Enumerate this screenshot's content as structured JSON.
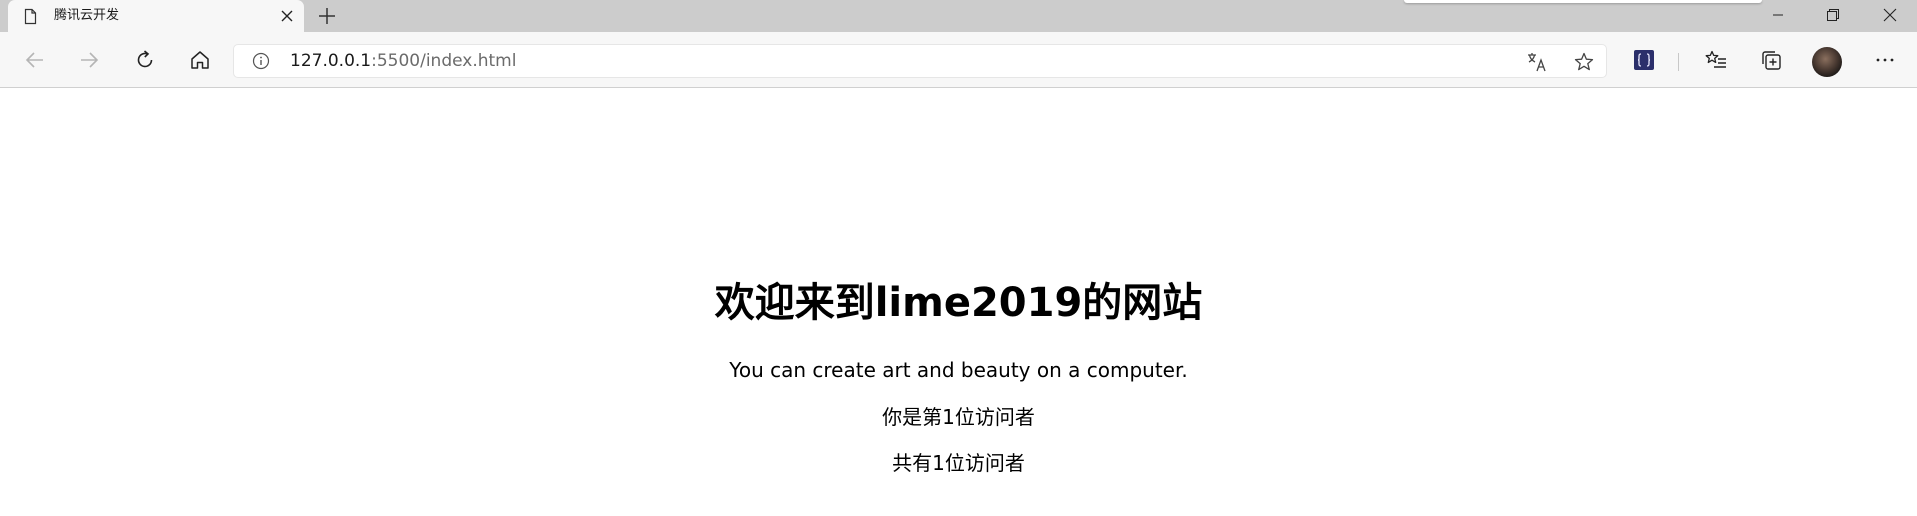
{
  "browser": {
    "tab": {
      "title": "腾讯云开发",
      "page_icon": "document-icon",
      "close_icon": "close-icon"
    },
    "new_tab_icon": "plus-icon",
    "window_controls": [
      "minimize-icon",
      "restore-icon",
      "close-icon"
    ],
    "nav": {
      "back_icon": "arrow-left-icon",
      "forward_icon": "arrow-right-icon",
      "refresh_icon": "refresh-icon",
      "home_icon": "home-icon"
    },
    "address": {
      "host": "127.0.0.1",
      "rest": ":5500/index.html",
      "info_icon": "info-icon"
    },
    "toolbar_icons": [
      "translate-icon",
      "star-icon",
      "extension-icon",
      "favorites-icon",
      "collections-icon",
      "avatar",
      "more-icon"
    ]
  },
  "page": {
    "heading": "欢迎来到lime2019的网站",
    "tagline": "You can create art and beauty on a computer.",
    "visitor_rank": "你是第1位访问者",
    "visitor_total": "共有1位访问者"
  },
  "colors": {
    "titlebar": "#cccccc",
    "toolbar": "#f7f7f7",
    "extension_accent": "#2b2f6b"
  }
}
